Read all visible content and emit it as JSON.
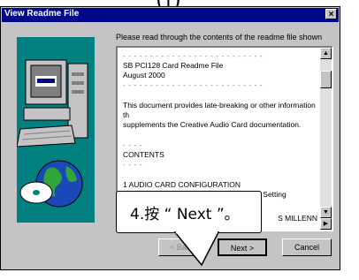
{
  "caption_fragment": "(|)",
  "window": {
    "title": "View Readme File",
    "close_glyph": "×"
  },
  "intro_text": "Please read through the contents of the readme file shown",
  "readme": {
    "dashes": "- - - - - - - - - - - - - - - - - - - - - - - - - -",
    "line1": "SB PCI128 Card Readme File",
    "line2": "August 2000",
    "para1": "This document provides late-breaking or other information th",
    "para2": "supplements the Creative Audio Card documentation.",
    "short_dash": "- - - -",
    "contents_heading": "CONTENTS",
    "item1": "1   AUDIO CARD CONFIGURATION",
    "item1_1": "    1.1  Changing the Interrupt Request (IRQ) Setting",
    "item_partial": "S MILLENN"
  },
  "buttons": {
    "back": "< Back",
    "next": "Next >",
    "cancel": "Cancel"
  },
  "callout": {
    "text": "4.按 “ Next ”。"
  },
  "colors": {
    "dialog_gray": "#c6c3c6",
    "titlebar_blue": "#00088a",
    "art_teal": "#00807f"
  }
}
